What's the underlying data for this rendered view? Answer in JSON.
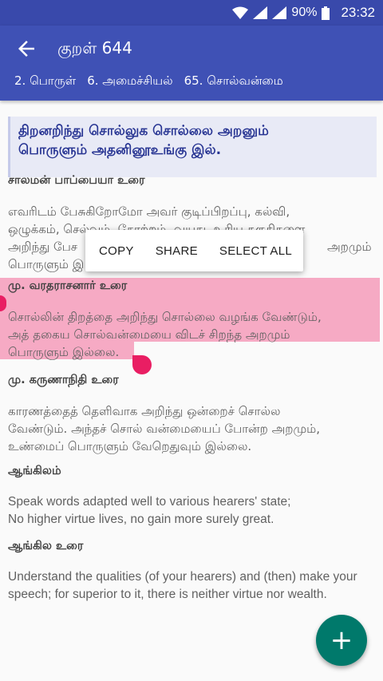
{
  "status_bar": {
    "battery_percent": "90%",
    "time": "23:32"
  },
  "app_bar": {
    "title": "குறள் 644",
    "breadcrumbs": [
      "2. பொருள்",
      "6. அமைச்சியல்",
      "65. சொல்வன்மை"
    ]
  },
  "kural": {
    "line1": "திறனறிந்து சொல்லுக சொல்லை அறனும்",
    "line2": "பொருளும் அதனினூஉங்கு இல்."
  },
  "sections": [
    {
      "heading": "சாலமன் பாப்பையா உரை",
      "lines": [
        "எவரிடம் பேசுகிறோமோ அவர் குடிப்பிறப்பு, கல்வி,",
        "ஒழுக்கம், செல்வம், கோற்றம், வயது, உரிய தகுதிகளை",
        "அறிந்து பேச",
        "பொருளும் இ"
      ],
      "line3_tail": "அறமும்"
    },
    {
      "heading": "மு. வரதராசனார் உரை",
      "lines": [
        "சொல்லின் திறத்தை அறிந்து சொல்லை வழங்க வேண்டும்,",
        "அத் தகைய சொல்வன்மையை விடச் சிறந்த அறமும்",
        "பொருளும் இல்லை."
      ]
    },
    {
      "heading": "மு. கருணாநிதி உரை",
      "lines": [
        "காரணத்தைத் தெளிவாக அறிந்து ஒன்றைச் சொல்ல",
        "வேண்டும். அந்தச் சொல் வன்மையைப் போன்ற அறமும்,",
        "உண்மைப் பொருளும் வேறெதுவும் இல்லை."
      ]
    },
    {
      "heading": "ஆங்கிலம்",
      "lines": [
        "Speak words adapted well to various hearers' state;",
        "No higher virtue lives, no gain more surely great."
      ]
    },
    {
      "heading": "ஆங்கில உரை",
      "lines": [
        "Understand the qualities (of your hearers) and (then) make your",
        "speech; for superior to it, there is neither virtue nor wealth."
      ]
    }
  ],
  "selection_menu": {
    "copy": "COPY",
    "share": "SHARE",
    "select_all": "SELECT ALL"
  },
  "fab": {
    "label": "+"
  },
  "colors": {
    "status_bar": "#3949ab",
    "app_bar": "#3f51b5",
    "highlight": "#f48fb1",
    "selection_handle": "#e91e63",
    "fab": "#00796b",
    "kural_text": "#283593"
  }
}
